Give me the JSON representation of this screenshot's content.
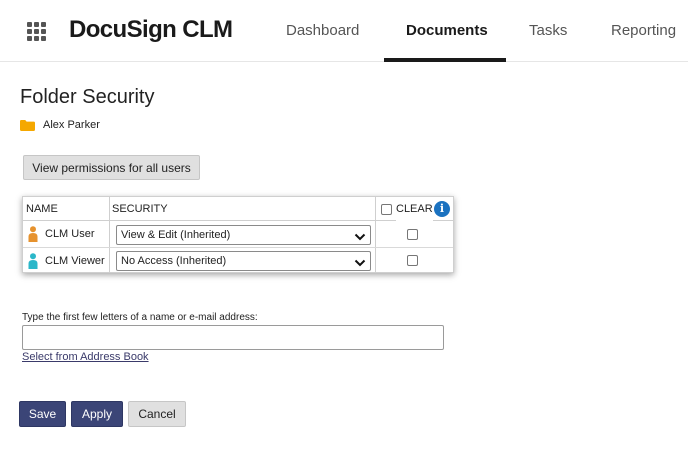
{
  "header": {
    "logo_text": "DocuSign CLM",
    "tabs": [
      {
        "label": "Dashboard",
        "active": false
      },
      {
        "label": "Documents",
        "active": true
      },
      {
        "label": "Tasks",
        "active": false
      },
      {
        "label": "Reporting",
        "active": false
      }
    ],
    "app_launcher_icon": "grid-icon"
  },
  "page": {
    "title": "Folder Security",
    "folder_owner": "Alex Parker",
    "folder_icon_color": "#f5a800"
  },
  "view_permissions_label": "View permissions for all users",
  "table": {
    "headers": {
      "name": "NAME",
      "security": "SECURITY",
      "clear": "CLEAR"
    },
    "rows": [
      {
        "name": "CLM User",
        "security": "View & Edit (Inherited)",
        "icon_color": "#e6922e",
        "clear_checked": false
      },
      {
        "name": "CLM Viewer",
        "security": "No Access (Inherited)",
        "icon_color": "#2bb7c9",
        "clear_checked": false
      }
    ],
    "info_icon_color": "#1b72c0"
  },
  "lookup": {
    "label": "Type the first few letters of a name or e-mail address:",
    "value": "",
    "address_book_link": "Select from Address Book"
  },
  "actions": {
    "save": "Save",
    "apply": "Apply",
    "cancel": "Cancel"
  },
  "colors": {
    "primary_button": "#3b4577",
    "active_tab_underline": "#1a1a1a"
  }
}
